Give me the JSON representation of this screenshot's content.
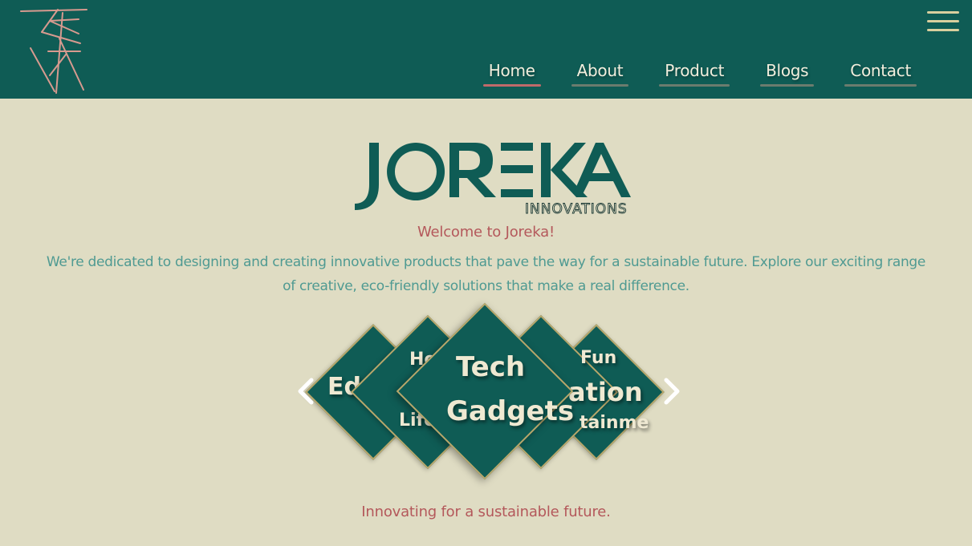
{
  "header": {
    "nav": [
      {
        "label": "Home",
        "active": true
      },
      {
        "label": "About",
        "active": false
      },
      {
        "label": "Product",
        "active": false
      },
      {
        "label": "Blogs",
        "active": false
      },
      {
        "label": "Contact",
        "active": false
      }
    ],
    "menu_icon": "hamburger-menu-icon",
    "logo_icon": "joreka-monogram-logo"
  },
  "brand": {
    "name": "JOREKA",
    "subtitle": "INNOVATIONS"
  },
  "hero": {
    "welcome": "Welcome to Joreka!",
    "intro": "We're dedicated to designing and creating innovative products that pave the way for a sustainable future. Explore our exciting range of creative, eco-friendly solutions that make a real difference."
  },
  "carousel": {
    "items": [
      {
        "visible_text": "Edu"
      },
      {
        "visible_text_top": "Ho",
        "visible_text_bottom": "Lifes"
      },
      {
        "line1": "Tech",
        "line2": "Gadgets"
      },
      {
        "visible_text": "ation"
      },
      {
        "visible_text_top": "Fun",
        "visible_text_bottom": "tainme"
      }
    ],
    "prev_icon": "chevron-left-icon",
    "next_icon": "chevron-right-icon"
  },
  "footer": {
    "tagline": "Innovating for a sustainable future."
  },
  "colors": {
    "header_bg": "#0f5c55",
    "page_bg": "#dfdcc3",
    "accent_red": "#b4585b",
    "text_teal": "#4f9a92",
    "gold": "#b8a76b"
  }
}
